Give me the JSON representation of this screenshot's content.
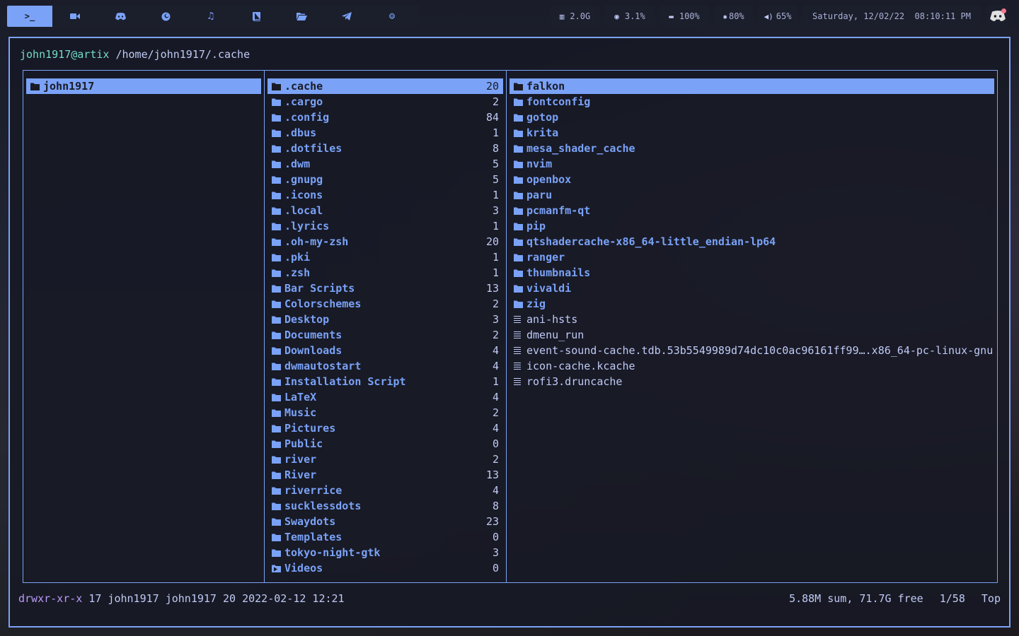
{
  "topbar": {
    "tags": [
      {
        "icon": "terminal-icon",
        "active": true
      },
      {
        "icon": "video-camera-icon",
        "active": false
      },
      {
        "icon": "discord-icon",
        "active": false
      },
      {
        "icon": "firefox-icon",
        "active": false
      },
      {
        "icon": "music-note-icon",
        "active": false
      },
      {
        "icon": "book-icon",
        "active": false
      },
      {
        "icon": "folder-open-icon",
        "active": false
      },
      {
        "icon": "telegram-icon",
        "active": false
      },
      {
        "icon": "gear-icon",
        "active": false
      }
    ],
    "memory": "2.0G",
    "cpu": "3.1%",
    "battery": "100%",
    "brightness": "80%",
    "volume": "65%",
    "datetime": "Saturday, 12/02/22  08:10:11 PM"
  },
  "header": {
    "user": "john1917@artix",
    "path": "/home/john1917/.cache"
  },
  "column1": [
    {
      "name": "john1917",
      "selected": true
    }
  ],
  "column2": [
    {
      "name": ".cache",
      "count": "20",
      "selected": true
    },
    {
      "name": ".cargo",
      "count": "2"
    },
    {
      "name": ".config",
      "count": "84"
    },
    {
      "name": ".dbus",
      "count": "1"
    },
    {
      "name": ".dotfiles",
      "count": "8"
    },
    {
      "name": ".dwm",
      "count": "5"
    },
    {
      "name": ".gnupg",
      "count": "5"
    },
    {
      "name": ".icons",
      "count": "1"
    },
    {
      "name": ".local",
      "count": "3"
    },
    {
      "name": ".lyrics",
      "count": "1"
    },
    {
      "name": ".oh-my-zsh",
      "count": "20"
    },
    {
      "name": ".pki",
      "count": "1"
    },
    {
      "name": ".zsh",
      "count": "1"
    },
    {
      "name": "Bar Scripts",
      "count": "13"
    },
    {
      "name": "Colorschemes",
      "count": "2"
    },
    {
      "name": "Desktop",
      "count": "3"
    },
    {
      "name": "Documents",
      "count": "2"
    },
    {
      "name": "Downloads",
      "count": "4"
    },
    {
      "name": "dwmautostart",
      "count": "4"
    },
    {
      "name": "Installation Script",
      "count": "1"
    },
    {
      "name": "LaTeX",
      "count": "4"
    },
    {
      "name": "Music",
      "count": "2"
    },
    {
      "name": "Pictures",
      "count": "4"
    },
    {
      "name": "Public",
      "count": "0"
    },
    {
      "name": "river",
      "count": "2"
    },
    {
      "name": "River",
      "count": "13"
    },
    {
      "name": "riverrice",
      "count": "4"
    },
    {
      "name": "sucklessdots",
      "count": "8"
    },
    {
      "name": "Swaydots",
      "count": "23"
    },
    {
      "name": "Templates",
      "count": "0"
    },
    {
      "name": "tokyo-night-gtk",
      "count": "3"
    },
    {
      "name": "Videos",
      "count": "0",
      "icon": "video-folder-icon"
    }
  ],
  "column3": [
    {
      "name": "falkon",
      "type": "dir",
      "selected": true
    },
    {
      "name": "fontconfig",
      "type": "dir"
    },
    {
      "name": "gotop",
      "type": "dir"
    },
    {
      "name": "krita",
      "type": "dir"
    },
    {
      "name": "mesa_shader_cache",
      "type": "dir"
    },
    {
      "name": "nvim",
      "type": "dir"
    },
    {
      "name": "openbox",
      "type": "dir"
    },
    {
      "name": "paru",
      "type": "dir"
    },
    {
      "name": "pcmanfm-qt",
      "type": "dir"
    },
    {
      "name": "pip",
      "type": "dir"
    },
    {
      "name": "qtshadercache-x86_64-little_endian-lp64",
      "type": "dir"
    },
    {
      "name": "ranger",
      "type": "dir"
    },
    {
      "name": "thumbnails",
      "type": "dir"
    },
    {
      "name": "vivaldi",
      "type": "dir"
    },
    {
      "name": "zig",
      "type": "dir"
    },
    {
      "name": "ani-hsts",
      "type": "file"
    },
    {
      "name": "dmenu_run",
      "type": "file"
    },
    {
      "name": "event-sound-cache.tdb.53b5549989d74dc10c0ac96161ff99….x86_64-pc-linux-gnu",
      "type": "file"
    },
    {
      "name": "icon-cache.kcache",
      "type": "file"
    },
    {
      "name": "rofi3.druncache",
      "type": "file"
    }
  ],
  "footer": {
    "perms": "drwxr-xr-x",
    "info": "17 john1917 john1917 20 2022-02-12 12:21",
    "disk": "5.88M sum, 71.7G free",
    "position": "1/58",
    "scroll": "Top"
  },
  "colors": {
    "accent": "#7aa2f7",
    "teal": "#73daca",
    "purple": "#bb9af7",
    "foreground": "#c0caf5",
    "background": "#1a1b26"
  }
}
